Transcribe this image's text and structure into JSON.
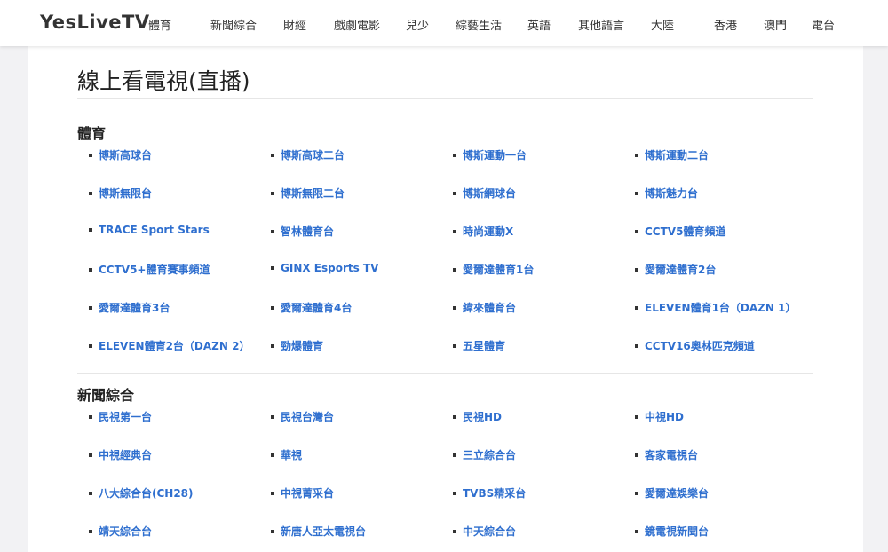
{
  "site": {
    "logo": "YesLiveTV",
    "nav": [
      "體育",
      "新聞綜合",
      "財經",
      "戲劇電影",
      "兒少",
      "綜藝生活",
      "英語",
      "其他語言",
      "大陸",
      "香港",
      "澳門",
      "電台"
    ]
  },
  "page": {
    "title": "線上看電視(直播)"
  },
  "sections": [
    {
      "title": "體育",
      "items": [
        "博斯高球台",
        "博斯高球二台",
        "博斯運動一台",
        "博斯運動二台",
        "博斯無限台",
        "博斯無限二台",
        "博斯網球台",
        "博斯魅力台",
        "TRACE Sport Stars",
        "智林體育台",
        "時尚運動X",
        "CCTV5體育頻道",
        "CCTV5+體育賽事頻道",
        "GINX Esports TV",
        "愛爾達體育1台",
        "愛爾達體育2台",
        "愛爾達體育3台",
        "愛爾達體育4台",
        "緯來體育台",
        "ELEVEN體育1台（DAZN 1）",
        "ELEVEN體育2台（DAZN 2）",
        "勁爆體育",
        "五星體育",
        "CCTV16奧林匹克頻道"
      ]
    },
    {
      "title": "新聞綜合",
      "items": [
        "民視第一台",
        "民視台灣台",
        "民視HD",
        "中視HD",
        "中視經典台",
        "華視",
        "三立綜合台",
        "客家電視台",
        "八大綜合台(CH28)",
        "中視菁采台",
        "TVBS精采台",
        "愛爾達娛樂台",
        "靖天綜合台",
        "新唐人亞太電視台",
        "中天綜合台",
        "鏡電視新聞台"
      ]
    }
  ]
}
